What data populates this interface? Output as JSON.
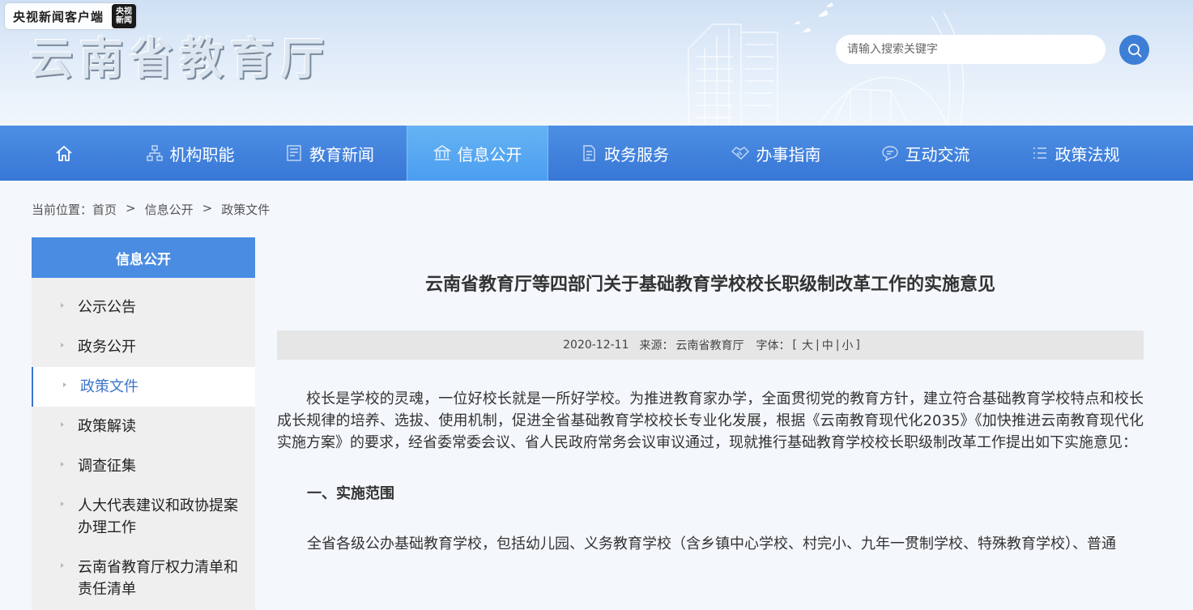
{
  "header": {
    "cctv_text": "央视新闻客户端",
    "cctv_logo_line1": "央视",
    "cctv_logo_line2": "新闻",
    "site_title": "云南省教育厅",
    "search_placeholder": "请输入搜索关键字",
    "search_icon": "search-icon"
  },
  "nav": {
    "items": [
      {
        "label": "",
        "icon": "home-icon"
      },
      {
        "label": "机构职能",
        "icon": "org-chart-icon"
      },
      {
        "label": "教育新闻",
        "icon": "news-icon"
      },
      {
        "label": "信息公开",
        "icon": "bank-icon",
        "active": true
      },
      {
        "label": "政务服务",
        "icon": "document-icon"
      },
      {
        "label": "办事指南",
        "icon": "handshake-icon"
      },
      {
        "label": "互动交流",
        "icon": "chat-icon"
      },
      {
        "label": "政策法规",
        "icon": "list-icon"
      }
    ]
  },
  "breadcrumb": {
    "prefix": "当前位置：",
    "items": [
      "首页",
      "信息公开",
      "政策文件"
    ],
    "separator": ">"
  },
  "sidebar": {
    "title": "信息公开",
    "items": [
      {
        "label": "公示公告"
      },
      {
        "label": "政务公开"
      },
      {
        "label": "政策文件",
        "active": true
      },
      {
        "label": "政策解读"
      },
      {
        "label": "调查征集"
      },
      {
        "label": "人大代表建议和政协提案办理工作"
      },
      {
        "label": "云南省教育厅权力清单和责任清单"
      }
    ]
  },
  "article": {
    "title": "云南省教育厅等四部门关于基础教育学校校长职级制改革工作的实施意见",
    "date": "2020-12-11",
    "source_label": "来源：",
    "source": "云南省教育厅",
    "font_label": "字体：",
    "font_sizes": [
      "大",
      "中",
      "小"
    ],
    "paragraph1": "校长是学校的灵魂，一位好校长就是一所好学校。为推进教育家办学，全面贯彻党的教育方针，建立符合基础教育学校特点和校长成长规律的培养、选拔、使用机制，促进全省基础教育学校校长专业化发展，根据《云南教育现代化2035》《加快推进云南教育现代化实施方案》的要求，经省委常委会议、省人民政府常务会议审议通过，现就推行基础教育学校校长职级制改革工作提出如下实施意见：",
    "section1": "一、实施范围",
    "paragraph2": "全省各级公办基础教育学校，包括幼儿园、义务教育学校（含乡镇中心学校、村完小、九年一贯制学校、特殊教育学校）、普通"
  },
  "colors": {
    "nav_blue": "#3f7fdc",
    "nav_active": "#59a8f2",
    "sidebar_head": "#4a8ce2",
    "active_link": "#3b74c9"
  }
}
